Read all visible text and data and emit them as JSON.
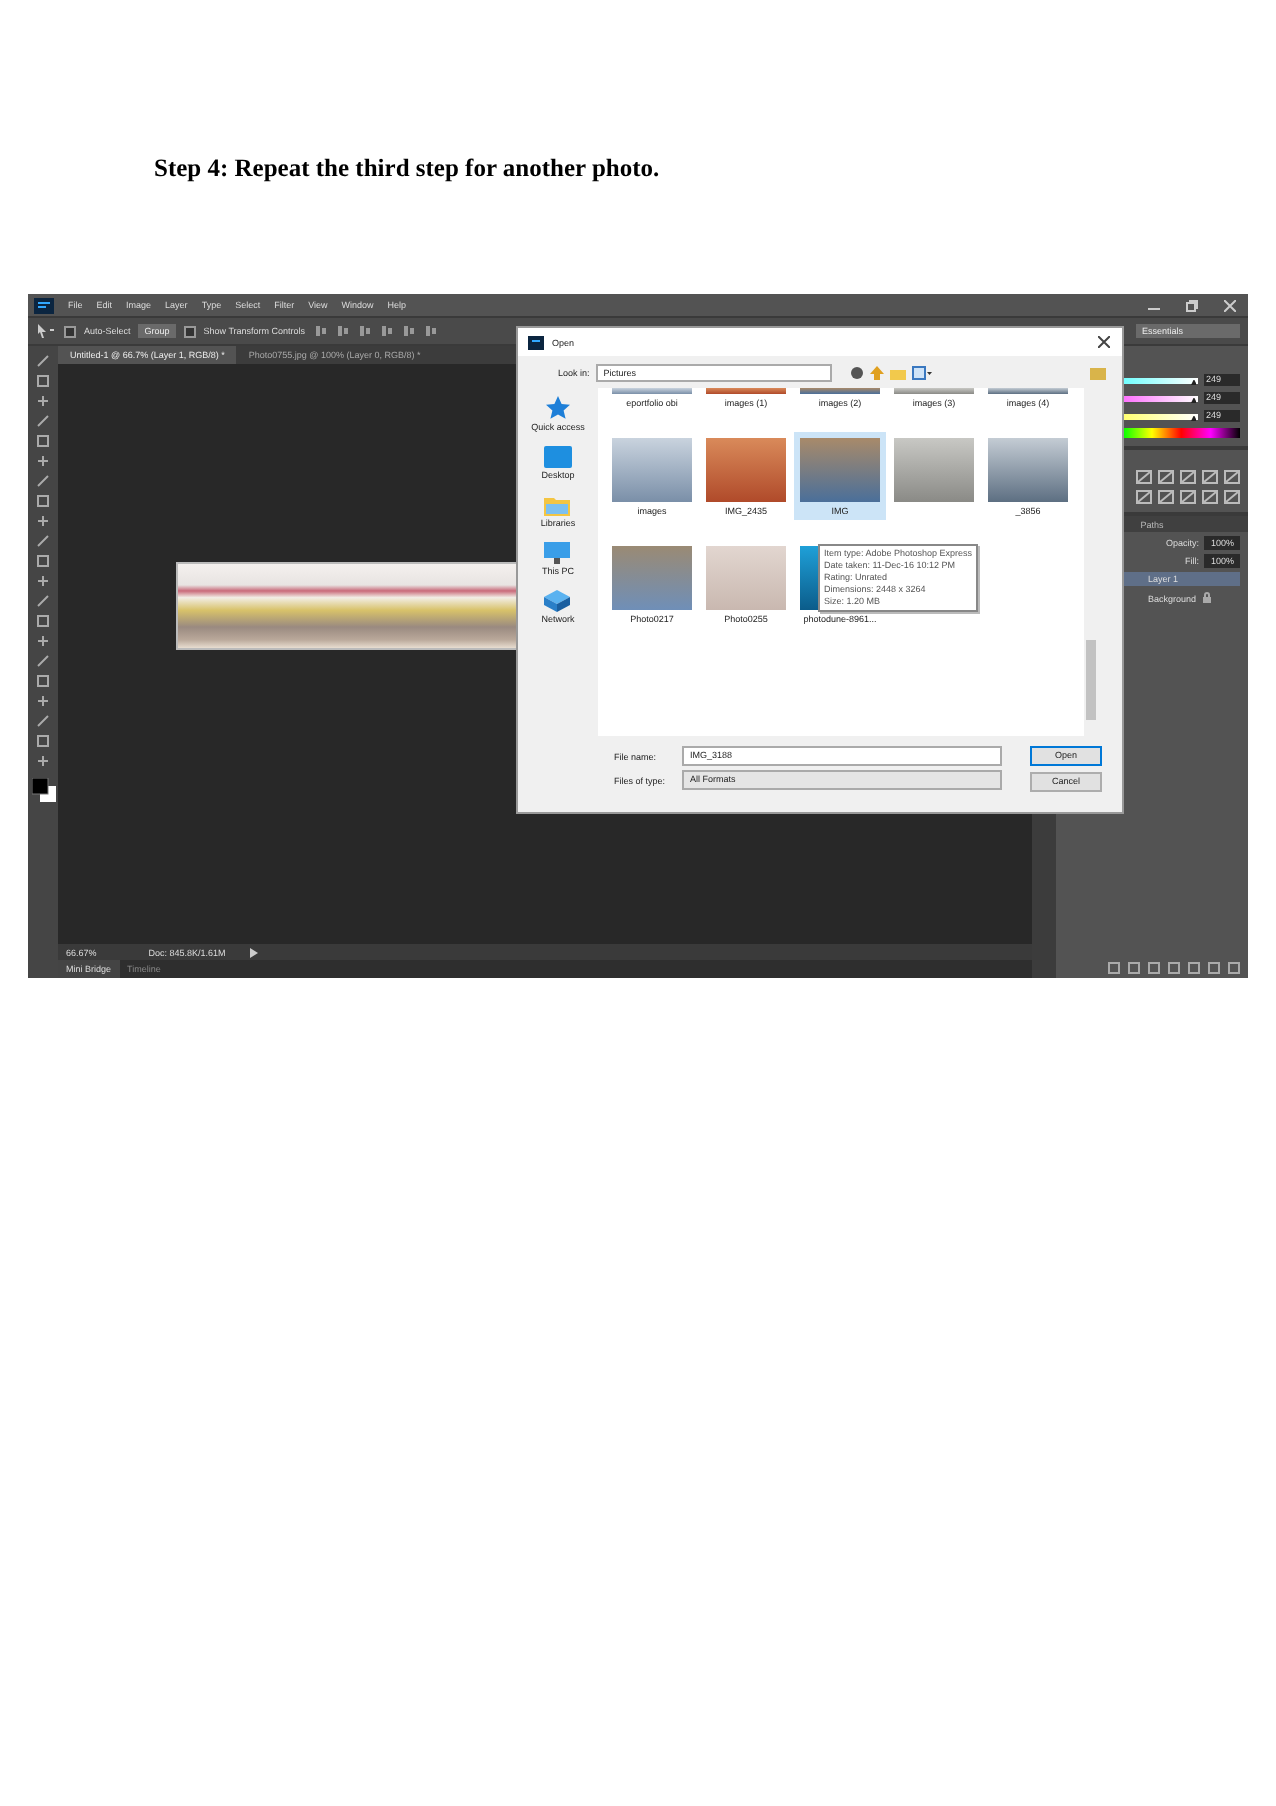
{
  "heading": "Step 4: Repeat the third step for another photo.",
  "app": {
    "menu": [
      "File",
      "Edit",
      "Image",
      "Layer",
      "Type",
      "Select",
      "Filter",
      "View",
      "Window",
      "Help"
    ],
    "options": {
      "auto_select": "Auto-Select",
      "auto_select_checked": false,
      "group": "Group",
      "show_transform": "Show Transform Controls",
      "show_transform_checked": false,
      "workspace": "Essentials"
    },
    "doc_tabs": [
      {
        "label": "Untitled-1 @ 66.7% (Layer 1, RGB/8) *",
        "selected": true
      },
      {
        "label": "Photo0755.jpg @ 100% (Layer 0, RGB/8) *",
        "selected": false
      }
    ],
    "status": {
      "zoom": "66.67%",
      "doc": "Doc: 845.8K/1.61M"
    },
    "bottom_tabs": [
      {
        "label": "Mini Bridge",
        "selected": true
      },
      {
        "label": "Timeline",
        "selected": false
      }
    ],
    "color_channels": [
      {
        "value": "249",
        "level": 0.97
      },
      {
        "value": "249",
        "level": 0.97
      },
      {
        "value": "249",
        "level": 0.97
      }
    ],
    "panel_tab": "Paths",
    "layers": {
      "opacity_label": "Opacity:",
      "opacity": "100%",
      "fill_label": "Fill:",
      "fill": "100%",
      "items": [
        {
          "name": "Layer 1",
          "selected": true,
          "locked": false
        },
        {
          "name": "Background",
          "selected": false,
          "locked": true
        }
      ]
    }
  },
  "dialog": {
    "title": "Open",
    "look_in_label": "Look in:",
    "look_in": "Pictures",
    "places": [
      {
        "label": "Quick access",
        "kind": "star"
      },
      {
        "label": "Desktop",
        "kind": "desktop"
      },
      {
        "label": "Libraries",
        "kind": "folder"
      },
      {
        "label": "This PC",
        "kind": "pc"
      },
      {
        "label": "Network",
        "kind": "network"
      }
    ],
    "rows": [
      [
        {
          "label": "eportfolio obi",
          "selected": false
        },
        {
          "label": "images (1)",
          "selected": false
        },
        {
          "label": "images (2)",
          "selected": false
        },
        {
          "label": "images (3)",
          "selected": false
        },
        {
          "label": "images (4)",
          "selected": false
        }
      ],
      [
        {
          "label": "images",
          "selected": false
        },
        {
          "label": "IMG_2435",
          "selected": false
        },
        {
          "label": "IMG",
          "selected": true
        },
        {
          "selected": false
        },
        {
          "label": "_3856",
          "selected": false
        }
      ],
      [
        {
          "label": "Photo0217",
          "selected": false
        },
        {
          "label": "Photo0255",
          "selected": false
        },
        {
          "label": "photodune-8961...",
          "selected": false
        }
      ]
    ],
    "tooltip": [
      "Item type: Adobe Photoshop Express",
      "Date taken: 11-Dec-16 10:12 PM",
      "Rating: Unrated",
      "Dimensions: 2448 x 3264",
      "Size: 1.20 MB"
    ],
    "file_name_label": "File name:",
    "file_name": "IMG_3188",
    "type_label": "Files of type:",
    "type": "All Formats",
    "buttons": [
      {
        "label": "Open",
        "kind": "primary"
      },
      {
        "label": "Cancel",
        "kind": "default"
      }
    ]
  }
}
